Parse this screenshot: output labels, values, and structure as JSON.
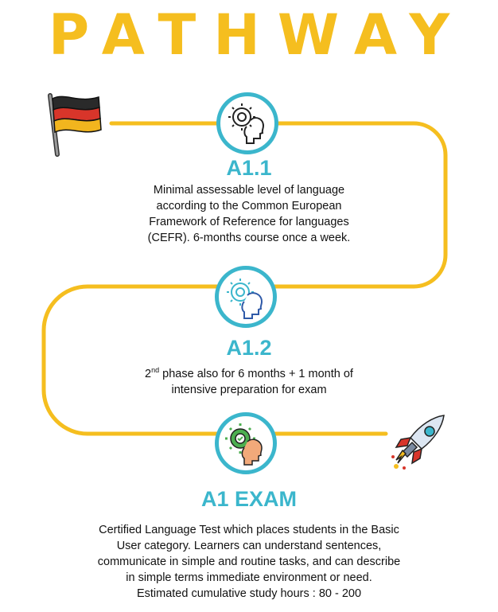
{
  "title": "PATHWAY",
  "colors": {
    "path": "#F5BE1F",
    "accent": "#3BB6CC",
    "text": "#111111"
  },
  "steps": [
    {
      "icon": "gear-head-icon",
      "label": "A1.1",
      "lines": [
        "Minimal assessable level of language",
        "according to the Common European",
        "Framework of Reference for languages",
        "(CEFR). 6-months course once a week."
      ]
    },
    {
      "icon": "gear-head-icon",
      "label": "A1.2",
      "line1_pre": "2",
      "line1_sup": "nd",
      "line1_post": " phase also for 6 months + 1 month of",
      "line2": "intensive preparation for exam"
    },
    {
      "icon": "gear-head-icon",
      "label": "A1 EXAM",
      "lines": [
        "Certified Language Test which places students in the Basic",
        "User category. Learners can understand sentences,",
        "communicate in simple and routine tasks, and can describe",
        "in simple terms immediate environment or need.",
        "Estimated cumulative study hours : 80 - 200"
      ]
    }
  ],
  "decorations": {
    "start_icon": "german-flag-icon",
    "end_icon": "rocket-icon"
  }
}
